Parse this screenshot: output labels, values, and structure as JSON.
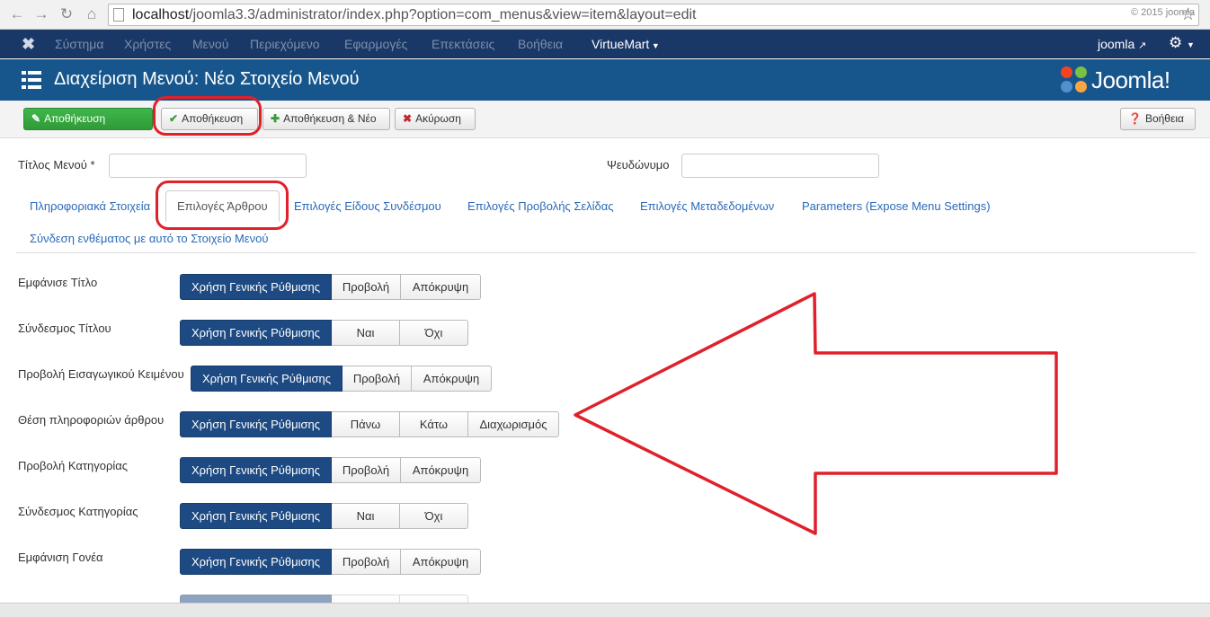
{
  "browser": {
    "url_host": "localhost",
    "url_path": "/joomla3.3/administrator/index.php?option=com_menus&view=item&layout=edit"
  },
  "admin_nav": {
    "items": [
      "Σύστημα",
      "Χρήστες",
      "Μενού",
      "Περιεχόμενο",
      "Εφαρμογές",
      "Επεκτάσεις",
      "Βοήθεια",
      "VirtueMart"
    ],
    "user": "joomla"
  },
  "header": {
    "title": "Διαχείριση Μενού: Νέο Στοιχείο Μενού",
    "logo_text": "Joomla!"
  },
  "toolbar": {
    "save_label": "Αποθήκευση",
    "save_close_label": "Αποθήκευση",
    "save_new_label": "Αποθήκευση & Νέο",
    "cancel_label": "Ακύρωση",
    "help_label": "Βοήθεια"
  },
  "form": {
    "menu_title_label": "Τίτλος Μενού *",
    "menu_title_value": "",
    "alias_label": "Ψευδώνυμο",
    "alias_value": ""
  },
  "tabs": [
    "Πληροφοριακά Στοιχεία",
    "Επιλογές Άρθρου",
    "Επιλογές Είδους Συνδέσμου",
    "Επιλογές Προβολής Σελίδας",
    "Επιλογές Μεταδεδομένων",
    "Parameters (Expose Menu Settings)",
    "Σύνδεση ενθέματος με αυτό το Στοιχείο Μενού"
  ],
  "options": [
    {
      "label": "Εμφάνισε Τίτλο",
      "choices": [
        "Χρήση Γενικής Ρύθμισης",
        "Προβολή",
        "Απόκρυψη"
      ]
    },
    {
      "label": "Σύνδεσμος Τίτλου",
      "choices": [
        "Χρήση Γενικής Ρύθμισης",
        "Ναι",
        "Όχι"
      ]
    },
    {
      "label": "Προβολή Εισαγωγικού Κειμένου",
      "choices": [
        "Χρήση Γενικής Ρύθμισης",
        "Προβολή",
        "Απόκρυψη"
      ]
    },
    {
      "label": "Θέση πληροφοριών άρθρου",
      "choices": [
        "Χρήση Γενικής Ρύθμισης",
        "Πάνω",
        "Κάτω",
        "Διαχωρισμός"
      ]
    },
    {
      "label": "Προβολή Κατηγορίας",
      "choices": [
        "Χρήση Γενικής Ρύθμισης",
        "Προβολή",
        "Απόκρυψη"
      ]
    },
    {
      "label": "Σύνδεσμος Κατηγορίας",
      "choices": [
        "Χρήση Γενικής Ρύθμισης",
        "Ναι",
        "Όχι"
      ]
    },
    {
      "label": "Εμφάνιση Γονέα",
      "choices": [
        "Χρήση Γενικής Ρύθμισης",
        "Προβολή",
        "Απόκρυψη"
      ]
    }
  ],
  "footer": {
    "copyright": "© 2015 joomla"
  },
  "colors": {
    "nav_bg": "#1a3867",
    "header_bg": "#17568c",
    "accent_green": "#2f9a38",
    "selected_segment": "#1d4a82",
    "annotation_red": "#e0202a"
  }
}
